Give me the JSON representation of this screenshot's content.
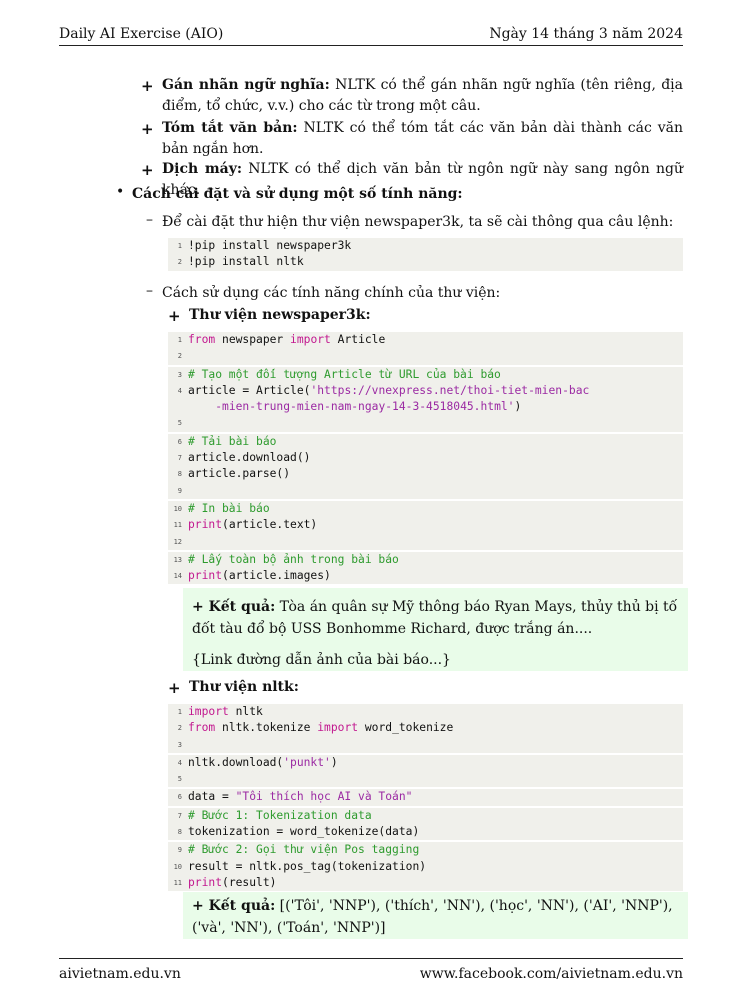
{
  "header": {
    "left": "Daily AI Exercise (AIO)",
    "right": "Ngày 14 tháng 3 năm 2024"
  },
  "footer": {
    "left": "aivietnam.edu.vn",
    "right": "www.facebook.com/aivietnam.edu.vn"
  },
  "features": [
    {
      "title": "Gán nhãn ngữ nghĩa:",
      "text": " NLTK có thể gán nhãn ngữ nghĩa (tên riêng, địa điểm, tổ chức, v.v.) cho các từ trong một câu."
    },
    {
      "title": "Tóm tắt văn bản:",
      "text": " NLTK có thể tóm tắt các văn bản dài thành các văn bản ngắn hơn."
    },
    {
      "title": "Dịch máy:",
      "text": " NLTK có thể dịch văn bản từ ngôn ngữ này sang ngôn ngữ khác."
    }
  ],
  "section_title": "Cách cài đặt và sử dụng một số tính năng:",
  "install_text": "Để cài đặt thư hiện thư viện newspaper3k, ta sẽ cài thông qua câu lệnh:",
  "install_code": [
    "!pip install newspaper3k",
    "!pip install nltk"
  ],
  "usage_text": "Cách sử dụng các tính năng chính của thư viện:",
  "lib1_title": "Thư viện newspaper3k:",
  "code1": {
    "l1_kw1": "from",
    "l1_mid": " newspaper ",
    "l1_kw2": "import",
    "l1_end": " Article",
    "l3": "# Tạo một đối tượng Article từ URL của bài báo",
    "l4_a": "article = Article(",
    "l4_s": "'https://vnexpress.net/thoi-tiet-mien-bac",
    "l4_cont": "-mien-trung-mien-nam-ngay-14-3-4518045.html'",
    "l4_end": ")",
    "l6": "# Tải bài báo",
    "l7": "article.download()",
    "l8": "article.parse()",
    "l10": "# In bài báo",
    "l11_kw": "print",
    "l11_end": "(article.text)",
    "l13": "# Lấy toàn bộ ảnh trong bài báo",
    "l14_kw": "print",
    "l14_end": "(article.images)"
  },
  "result1": {
    "label": "Kết quả:",
    "text": " Tòa án quân sự Mỹ thông báo Ryan Mays, thủy thủ bị tố đốt tàu đổ bộ USS Bonhomme Richard, được trắng án....",
    "link": "{Link đường dẫn ảnh của bài báo...}"
  },
  "lib2_title": "Thư viện nltk:",
  "code2": {
    "l1_kw": "import",
    "l1_end": " nltk",
    "l2_kw1": "from",
    "l2_mid": " nltk.tokenize ",
    "l2_kw2": "import",
    "l2_end": " word_tokenize",
    "l4_a": "nltk.download(",
    "l4_s": "'punkt'",
    "l4_end": ")",
    "l6_a": "data = ",
    "l6_s": "\"Tôi thích học AI và Toán\"",
    "l7": "# Bước 1: Tokenization data",
    "l8": "tokenization = word_tokenize(data)",
    "l9": "# Bước 2: Gọi thư viện Pos tagging",
    "l10": "result = nltk.pos_tag(tokenization)",
    "l11_kw": "print",
    "l11_end": "(result)"
  },
  "result2": {
    "label": "Kết quả:",
    "text": " [('Tôi', 'NNP'), ('thích', 'NN'), ('học', 'NN'), ('AI', 'NNP'), ('và', 'NN'), ('Toán', 'NNP')]"
  }
}
